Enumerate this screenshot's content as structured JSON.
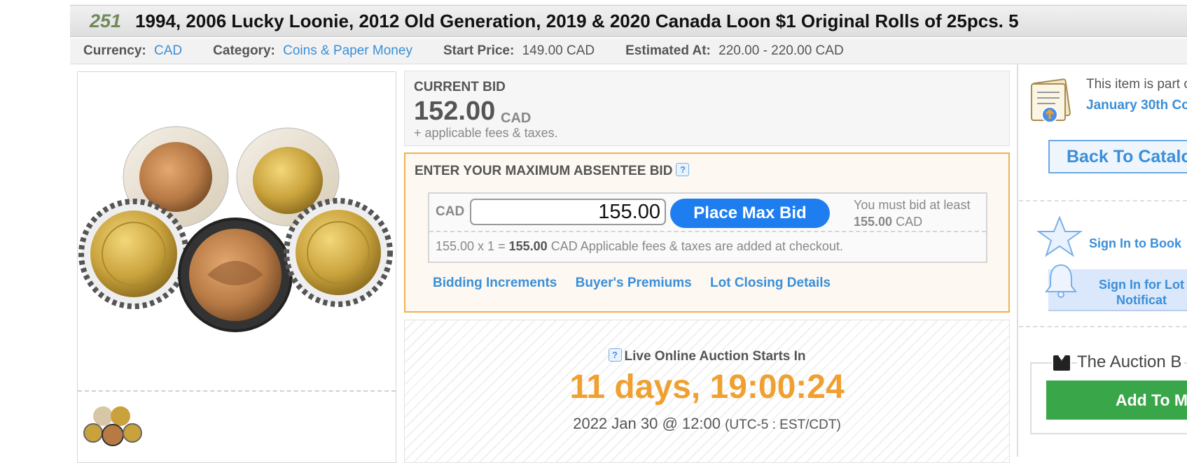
{
  "lot": {
    "number": "251",
    "title": "1994, 2006 Lucky Loonie, 2012 Old Generation, 2019 & 2020 Canada Loon $1 Original Rolls of 25pcs. 5"
  },
  "meta": {
    "currency_label": "Currency:",
    "currency_value": "CAD",
    "category_label": "Category:",
    "category_value": "Coins & Paper Money",
    "start_label": "Start Price:",
    "start_value": "149.00 CAD",
    "estimate_label": "Estimated At:",
    "estimate_value": "220.00 - 220.00 CAD"
  },
  "current_bid": {
    "label": "CURRENT BID",
    "amount": "152.00",
    "currency": "CAD",
    "fees": "+ applicable fees & taxes."
  },
  "absentee": {
    "title": "ENTER YOUR MAXIMUM ABSENTEE BID",
    "help": "?",
    "currency": "CAD",
    "bid_value": "155.00",
    "place_bid": "Place Max Bid",
    "min_text": "You must bid at least",
    "min_amount": "155.00",
    "min_currency": "CAD",
    "summary_prefix": "155.00 x 1 =",
    "summary_amount": "155.00",
    "summary_suffix": "CAD  Applicable fees & taxes are added at checkout.",
    "links": {
      "increments": "Bidding Increments",
      "premiums": "Buyer's Premiums",
      "closing": "Lot Closing Details"
    }
  },
  "countdown": {
    "help": "?",
    "label": "Live Online Auction Starts In",
    "timer": "11 days, 19:00:24",
    "date": "2022 Jan 30 @ 12:00",
    "tz": "(UTC-5 : EST/CDT)"
  },
  "sidebar": {
    "catalog_text": "This item is part of",
    "catalog_link": "January 30th Co",
    "back_button": "Back To Catalog",
    "sign_in_book": "Sign In to Book",
    "sign_in_lot_line1": "Sign In for Lot",
    "sign_in_lot_line2": "Notificat",
    "auction_title": "The Auction B",
    "add_button": "Add To M"
  }
}
